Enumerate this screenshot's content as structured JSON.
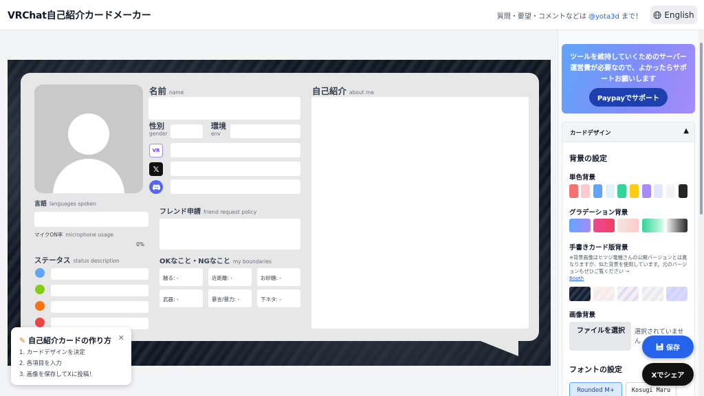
{
  "header": {
    "title": "VRChat自己紹介カードメーカー",
    "contact_prefix": "質問・要望・コメントなどは ",
    "contact_handle": "@yota3d",
    "contact_suffix": " まで！",
    "language_button": "English"
  },
  "card": {
    "name": {
      "jp": "名前",
      "en": "name"
    },
    "gender": {
      "jp": "性別",
      "en": "gender"
    },
    "env": {
      "jp": "環境",
      "en": "env"
    },
    "about": {
      "jp": "自己紹介",
      "en": "about me"
    },
    "languages": {
      "jp": "言語",
      "en": "languages spoken"
    },
    "mic": {
      "jp": "マイクON率",
      "en": "microphone usage",
      "value": "0%"
    },
    "friend": {
      "jp": "フレンド申請",
      "en": "friend request policy"
    },
    "status": {
      "jp": "ステータス",
      "en": "status description"
    },
    "boundaries": {
      "jp": "OKなこと・NGなこと",
      "en": "my boundaries"
    },
    "ng_items": [
      "触る: -",
      "近距離: -",
      "お砂糖: -",
      "武器: -",
      "暴言/暴力: -",
      "下ネタ: -"
    ],
    "sns_icons": [
      "vrchat-icon",
      "x-icon",
      "discord-icon"
    ],
    "status_colors": [
      "#60a5fa",
      "#84cc16",
      "#f97316",
      "#ef4444"
    ]
  },
  "howto": {
    "title": "自己紹介カードの作り方",
    "steps": [
      "1. カードデザインを決定",
      "2. 各項目を入力",
      "3. 画像を保存してXに投稿！"
    ]
  },
  "sidebar": {
    "promo_text": "ツールを維持していくためのサーバー運営費が必要なので、よかったらサポートお願いします",
    "promo_button": "Paypayでサポート",
    "panel_title": "カードデザイン",
    "bg_heading": "背景の設定",
    "solid_heading": "単色背景",
    "solid_colors": [
      "#f87171",
      "#fecaca",
      "#60a5fa",
      "#e0f2fe",
      "#34d399",
      "#facc15",
      "#a78bfa",
      "#e0e7ff",
      "#f3f4f6",
      "#262626"
    ],
    "gradient_heading": "グラデーション背景",
    "handwritten_heading": "手書きカード版背景",
    "handwritten_note": "※背景画像はヒツジ電機さんの公開バージョンとは異なりますが、似た背景を使用しています。元のバージョンもぜひご覧ください →",
    "handwritten_link": "Booth",
    "image_heading": "画像背景",
    "file_button": "ファイルを選択",
    "file_status": "選択されていません",
    "font_heading": "フォントの設定",
    "fonts": [
      "Rounded M+",
      "Kosugi Maru"
    ]
  },
  "actions": {
    "save": "保存",
    "share": "Xでシェア"
  }
}
